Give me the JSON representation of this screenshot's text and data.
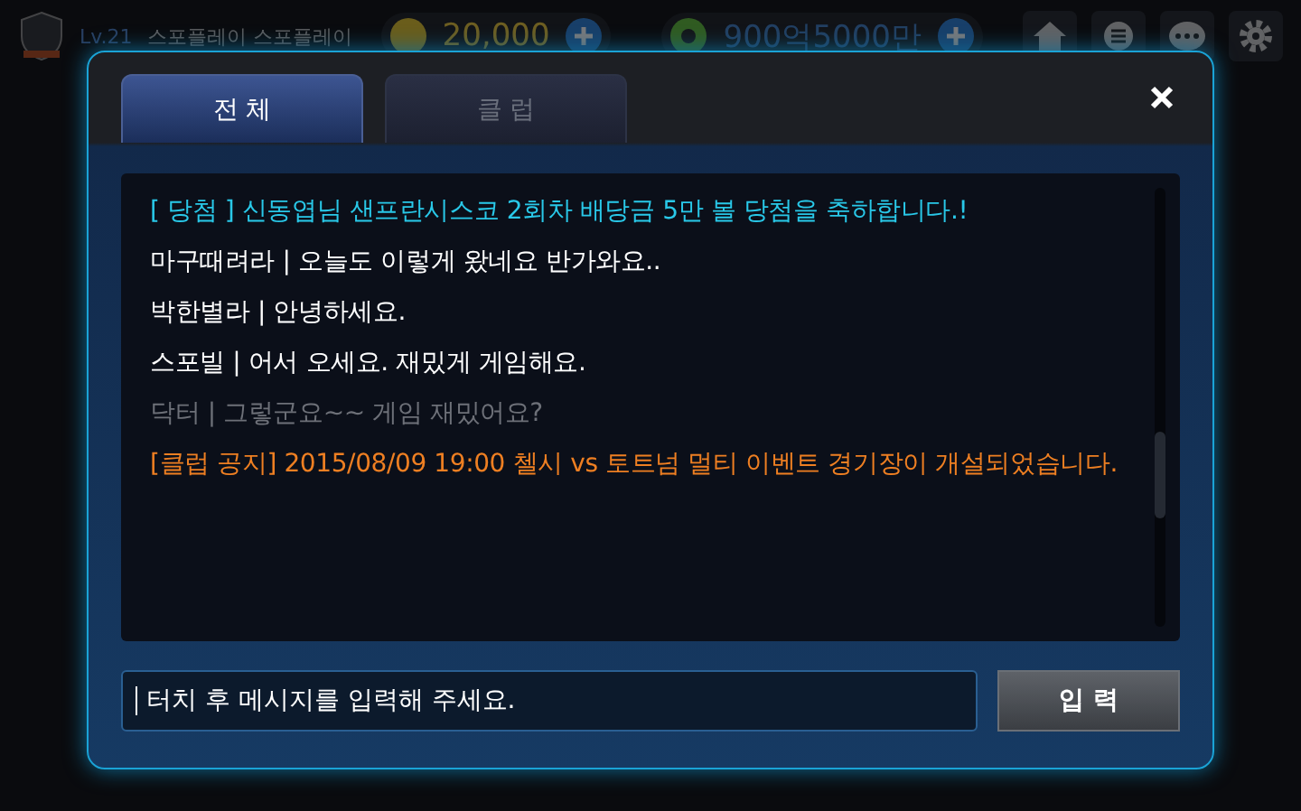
{
  "top_bar": {
    "level": "Lv.21",
    "player": "스포플레이 스포플레이",
    "coins": "20,000",
    "balls": "900억5000만"
  },
  "dialog": {
    "tabs": [
      {
        "label": "전 체",
        "selected": true
      },
      {
        "label": "클 럽",
        "selected": false
      }
    ],
    "messages": [
      {
        "kind": "notice",
        "text": "[ 당첨 ] 신동엽님  샌프란시스코 2회차 배당금 5만 볼 당첨을 축하합니다.!"
      },
      {
        "kind": "chat",
        "text": "마구때려라 | 오늘도 이렇게 왔네요 반가와요.."
      },
      {
        "kind": "chat",
        "text": "박한별라 | 안녕하세요."
      },
      {
        "kind": "chat",
        "text": "스포빌 |  어서 오세요. 재밌게 게임해요."
      },
      {
        "kind": "faded",
        "text": "닥터 | 그렇군요~~ 게임 재밌어요?"
      },
      {
        "kind": "club",
        "text": "[클럽 공지] 2015/08/09 19:00 첼시 vs 토트넘 멀티 이벤트 경기장이 개설되었습니다."
      }
    ],
    "input": {
      "placeholder": "터치 후 메시지를 입력해 주세요."
    },
    "send_button": "입 력"
  }
}
